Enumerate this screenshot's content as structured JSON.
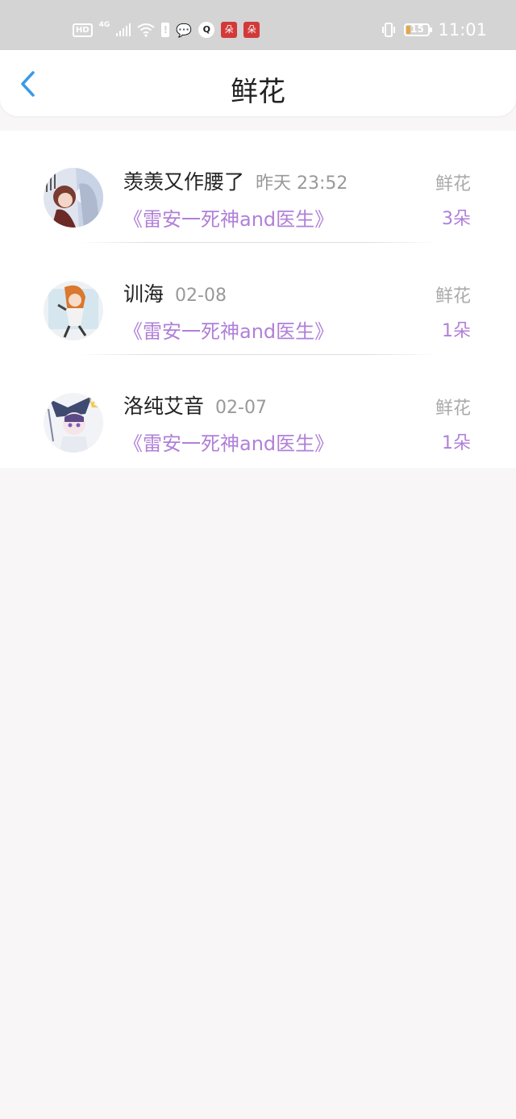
{
  "status_bar": {
    "hd": "HD",
    "network": "4G",
    "alert": "!",
    "wechat_icon": "💬",
    "qq_icon": "Q",
    "app_badge": "朵",
    "battery": "15",
    "time": "11:01",
    "icons": [
      "hd-icon",
      "signal-icon",
      "wifi-icon",
      "alert-icon",
      "wechat-icon",
      "qq-icon",
      "app-icon",
      "app-icon",
      "vibrate-icon",
      "battery-icon"
    ]
  },
  "header": {
    "title": "鲜花",
    "back_icon": "chevron-left-icon"
  },
  "colors": {
    "accent": "#b080d8",
    "back": "#3b9ae8",
    "background": "#f8f6f7"
  },
  "items": [
    {
      "name": "羡羡又作腰了",
      "time": "昨天 23:52",
      "book": "《雷安一死神and医生》",
      "type": "鲜花",
      "count": "3朵"
    },
    {
      "name": "训海",
      "time": "02-08",
      "book": "《雷安一死神and医生》",
      "type": "鲜花",
      "count": "1朵"
    },
    {
      "name": "洛纯艾音",
      "time": "02-07",
      "book": "《雷安一死神and医生》",
      "type": "鲜花",
      "count": "1朵"
    }
  ]
}
